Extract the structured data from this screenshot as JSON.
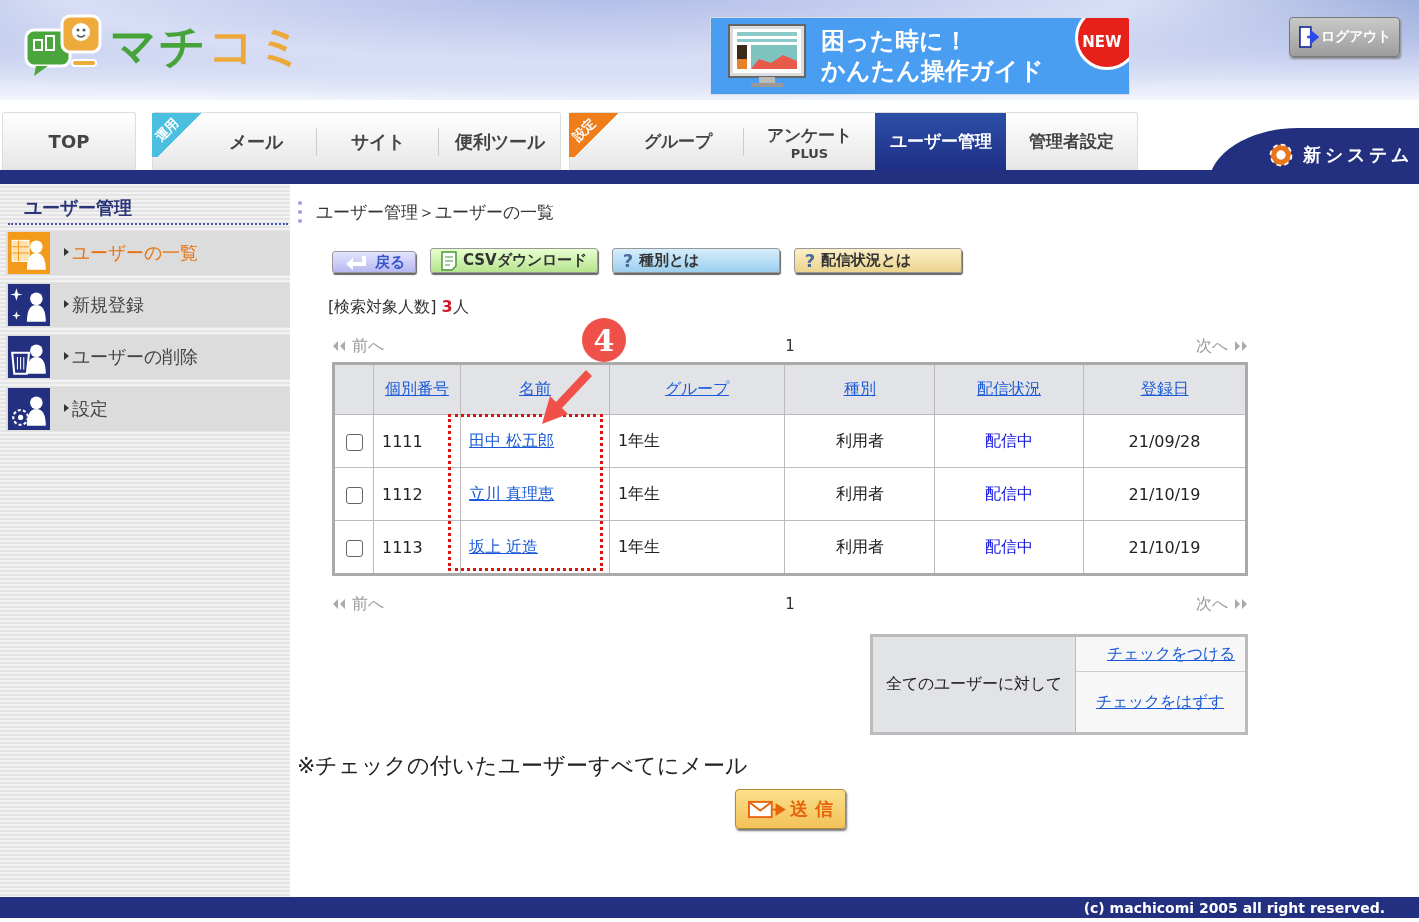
{
  "header": {
    "logo": "マチコミ",
    "guide": {
      "line_1": "困った時に！",
      "line_2": "かんたん操作ガイド",
      "badge": "NEW"
    },
    "logout": "ログアウト"
  },
  "nav": {
    "groups": [
      {
        "tabs": [
          {
            "label": "TOP",
            "selected": false
          }
        ]
      },
      {
        "ribbon": {
          "label": "運用",
          "color": "#4bbfe0"
        },
        "tabs": [
          {
            "label": "メール",
            "selected": false
          },
          {
            "label": "サイト",
            "selected": false
          },
          {
            "label": "便利ツール",
            "selected": false
          }
        ]
      },
      {
        "ribbon": {
          "label": "設定",
          "color": "#ef7d1a"
        },
        "tabs": [
          {
            "label": "グループ",
            "selected": false
          },
          {
            "label": "アンケート",
            "sub": "PLUS",
            "selected": false
          },
          {
            "label": "ユーザー管理",
            "selected": true
          },
          {
            "label": "管理者設定",
            "selected": false
          }
        ]
      }
    ],
    "system": "新システム"
  },
  "sidebar": {
    "title": "ユーザー管理",
    "items": [
      {
        "kind": "list",
        "label": "ユーザーの一覧",
        "selected": true
      },
      {
        "kind": "add",
        "label": "新規登録",
        "selected": false
      },
      {
        "kind": "delete",
        "label": "ユーザーの削除",
        "selected": false
      },
      {
        "kind": "settings",
        "label": "設定",
        "selected": false
      }
    ]
  },
  "breadcrumb": "ユーザー管理＞ユーザーの一覧",
  "buttons": [
    {
      "kind": "back",
      "label": "戻る"
    },
    {
      "kind": "csv",
      "label": "CSVダウンロード"
    },
    {
      "kind": "help",
      "mark": "?",
      "label": "種別とは"
    },
    {
      "kind": "help2",
      "mark": "?",
      "label": "配信状況とは"
    }
  ],
  "result_count": {
    "label": "[検索対象人数]",
    "count": "3",
    "unit": "人"
  },
  "pager": {
    "prev": "前へ",
    "page": "1",
    "next": "次へ"
  },
  "table": {
    "columns": [
      "個別番号",
      "名前",
      "グループ",
      "種別",
      "配信状況",
      "登録日"
    ],
    "rows": [
      {
        "checked": false,
        "number": "1111",
        "name": "田中 松五郎",
        "group": "1年生",
        "type": "利用者",
        "status": "配信中",
        "date": "21/09/28"
      },
      {
        "checked": false,
        "number": "1112",
        "name": "立川 真理恵",
        "group": "1年生",
        "type": "利用者",
        "status": "配信中",
        "date": "21/10/19"
      },
      {
        "checked": false,
        "number": "1113",
        "name": "坂上 近造",
        "group": "1年生",
        "type": "利用者",
        "status": "配信中",
        "date": "21/10/19"
      }
    ]
  },
  "pager_bottom": {
    "prev": "前へ",
    "page": "1",
    "next": "次へ"
  },
  "annotation": {
    "number": "4"
  },
  "check_all": {
    "label": "全てのユーザーに対して",
    "check": "チェックをつける",
    "uncheck": "チェックをはずす"
  },
  "note": "※チェックの付いたユーザーすべてにメール",
  "send": "送 信",
  "footer": "(c) machicomi 2005 all right reserved."
}
